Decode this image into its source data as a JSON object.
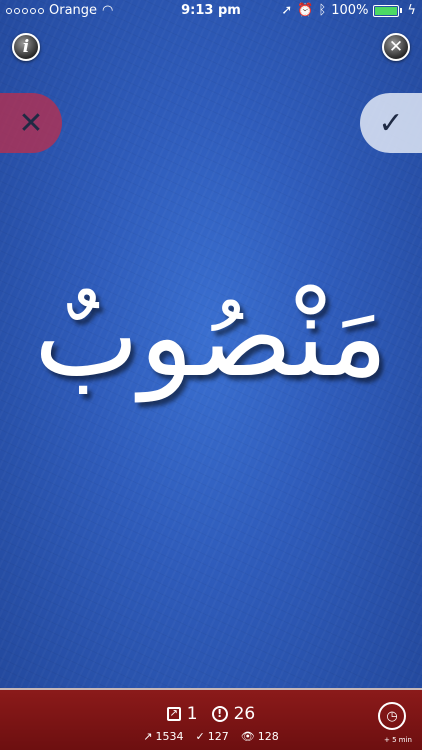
{
  "status_bar": {
    "carrier": "Orange",
    "time": "9:13 pm",
    "battery": "100%",
    "icons": [
      "wifi-icon",
      "location-icon",
      "alarm-icon",
      "bluetooth-icon",
      "battery-icon",
      "charging-icon"
    ]
  },
  "toolbar": {
    "info_icon": "i",
    "close_icon": "✕"
  },
  "answer_buttons": {
    "wrong_icon": "✕",
    "right_icon": "✓"
  },
  "card": {
    "word": "مَنْصُوبٌ"
  },
  "stats": {
    "cards": "1",
    "alerts": "26",
    "trend": "1534",
    "correct": "127",
    "seen": "128",
    "trend_icon": "↗",
    "correct_icon": "✓",
    "seen_icon": "👁"
  },
  "timer": {
    "label": "+ 5 min"
  },
  "colors": {
    "background": "#2f5cbb",
    "bottom_bar": "#7a1414",
    "wrong": "#be2d4b",
    "right": "#e1e8f6"
  }
}
